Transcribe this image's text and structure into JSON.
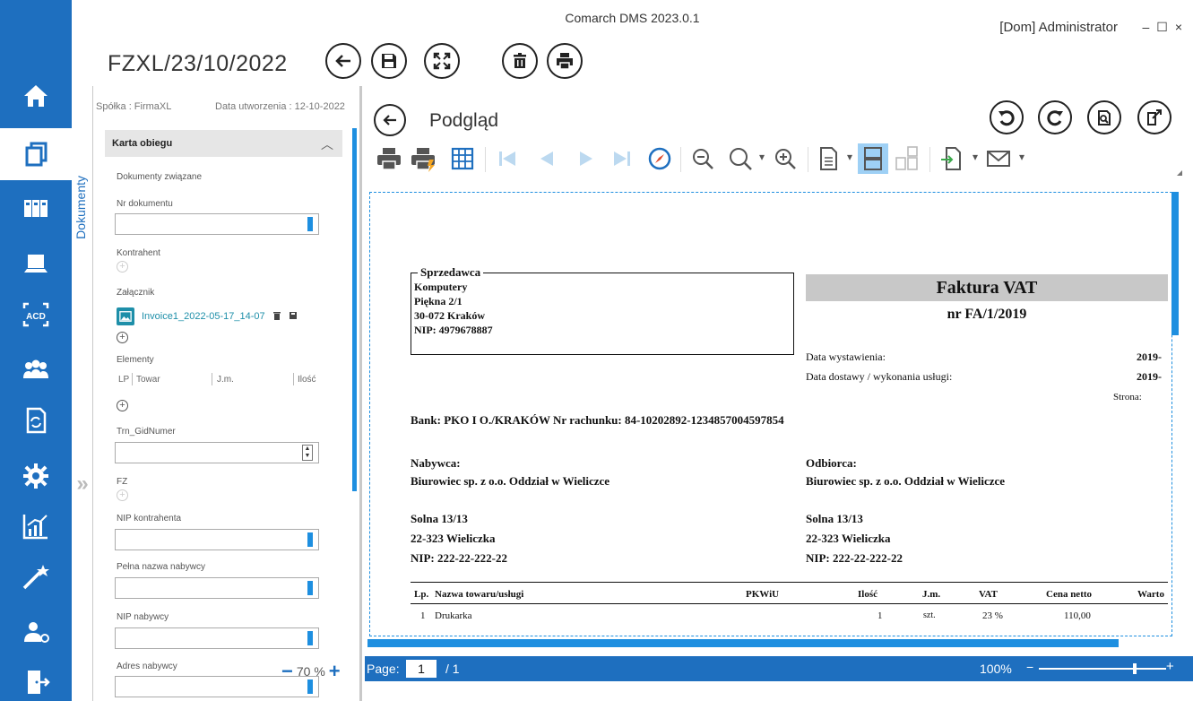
{
  "app": {
    "title": "Comarch DMS 2023.0.1",
    "user": "[Dom]  Administrator",
    "window_controls": [
      "–",
      "☐",
      "×"
    ]
  },
  "rail": {
    "items": [
      "home-icon",
      "documents-icon",
      "library-icon",
      "workstation-icon",
      "ocr-icon",
      "users-icon",
      "process-icon",
      "settings-icon",
      "reports-icon",
      "wizard-icon",
      "admin-icon",
      "logout-icon"
    ]
  },
  "document": {
    "title": "FZXL/23/10/2022"
  },
  "sidebar_tab": {
    "label": "Dokumenty"
  },
  "form": {
    "company": "Spółka : FirmaXL",
    "created": "Data utworzenia : 12-10-2022",
    "section": "Karta obiegu",
    "related_docs": "Dokumenty związane",
    "doc_number_label": "Nr dokumentu",
    "contractor_label": "Kontrahent",
    "attachment_label": "Załącznik",
    "attachment_name": "Invoice1_2022-05-17_14-07",
    "elements_label": "Elementy",
    "elements_columns": [
      "LP",
      "Towar",
      "J.m.",
      "Ilość"
    ],
    "gid_label": "Trn_GidNumer",
    "fz_label": "FZ",
    "nip_contractor_label": "NIP kontrahenta",
    "buyer_name_label": "Pełna nazwa nabywcy",
    "buyer_nip_label": "NIP nabywcy",
    "buyer_address_label": "Adres nabywcy",
    "zoom": "70 %"
  },
  "preview": {
    "title": "Podgląd",
    "page_label": "Page:",
    "page_current": "1",
    "page_total": "/ 1",
    "zoom": "100%",
    "zoom_level": 0.75
  },
  "invoice": {
    "seller_label": "Sprzedawca",
    "seller_lines": [
      "Komputery",
      "Piękna 2/1",
      "30-072 Kraków",
      "NIP: 4979678887"
    ],
    "title": "Faktura VAT",
    "number": "nr FA/1/2019",
    "issue_date_label": "Data wystawienia:",
    "issue_date": "2019-",
    "delivery_date_label": "Data dostawy / wykonania usługi:",
    "delivery_date": "2019-",
    "page_label": "Strona:",
    "bank": "Bank: PKO I O./KRAKÓW   Nr rachunku: 84-10202892-1234857004597854",
    "buyer_label": "Nabywca:",
    "recipient_label": "Odbiorca:",
    "buyer_name": "Biurowiec sp. z o.o. Oddział w Wieliczce",
    "recipient_name": "Biurowiec sp. z o.o. Oddział w Wieliczce",
    "buyer_street": "Solna 13/13",
    "recipient_street": "Solna 13/13",
    "buyer_city": "22-323 Wieliczka",
    "recipient_city": "22-323 Wieliczka",
    "buyer_nip": "NIP: 222-22-222-22",
    "recipient_nip": "NIP: 222-22-222-22",
    "columns": [
      "Lp.",
      "Nazwa towaru/usługi",
      "PKWiU",
      "Ilość",
      "J.m.",
      "VAT",
      "Cena netto",
      "Warto"
    ],
    "row": [
      "1",
      "Drukarka",
      "",
      "1",
      "szt.",
      "23 %",
      "110,00",
      ""
    ]
  }
}
